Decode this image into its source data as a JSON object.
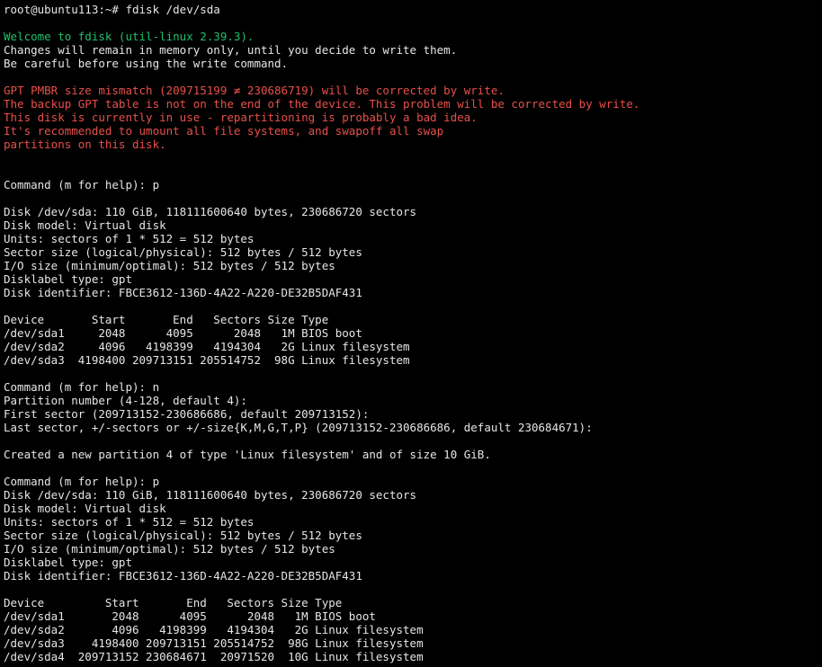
{
  "colors": {
    "background": "#000000",
    "text": "#e6e6e6",
    "welcome": "#20c06a",
    "warning": "#e8504a"
  },
  "lines": [
    {
      "text": "root@ubuntu113:~# fdisk /dev/sda",
      "color": "white"
    },
    {
      "text": "",
      "color": "white"
    },
    {
      "text": "Welcome to fdisk (util-linux 2.39.3).",
      "color": "green"
    },
    {
      "text": "Changes will remain in memory only, until you decide to write them.",
      "color": "white"
    },
    {
      "text": "Be careful before using the write command.",
      "color": "white"
    },
    {
      "text": "",
      "color": "white"
    },
    {
      "text": "GPT PMBR size mismatch (209715199 ≠ 230686719) will be corrected by write.",
      "color": "red"
    },
    {
      "text": "The backup GPT table is not on the end of the device. This problem will be corrected by write.",
      "color": "red"
    },
    {
      "text": "This disk is currently in use - repartitioning is probably a bad idea.",
      "color": "red"
    },
    {
      "text": "It's recommended to umount all file systems, and swapoff all swap",
      "color": "red"
    },
    {
      "text": "partitions on this disk.",
      "color": "red"
    },
    {
      "text": "",
      "color": "white"
    },
    {
      "text": "",
      "color": "white"
    },
    {
      "text": "Command (m for help): p",
      "color": "white"
    },
    {
      "text": "",
      "color": "white"
    },
    {
      "text": "Disk /dev/sda: 110 GiB, 118111600640 bytes, 230686720 sectors",
      "color": "white"
    },
    {
      "text": "Disk model: Virtual disk",
      "color": "white"
    },
    {
      "text": "Units: sectors of 1 * 512 = 512 bytes",
      "color": "white"
    },
    {
      "text": "Sector size (logical/physical): 512 bytes / 512 bytes",
      "color": "white"
    },
    {
      "text": "I/O size (minimum/optimal): 512 bytes / 512 bytes",
      "color": "white"
    },
    {
      "text": "Disklabel type: gpt",
      "color": "white"
    },
    {
      "text": "Disk identifier: FBCE3612-136D-4A22-A220-DE32B5DAF431",
      "color": "white"
    },
    {
      "text": "",
      "color": "white"
    },
    {
      "text": "Device       Start       End   Sectors Size Type",
      "color": "white"
    },
    {
      "text": "/dev/sda1     2048      4095      2048   1M BIOS boot",
      "color": "white"
    },
    {
      "text": "/dev/sda2     4096   4198399   4194304   2G Linux filesystem",
      "color": "white"
    },
    {
      "text": "/dev/sda3  4198400 209713151 205514752  98G Linux filesystem",
      "color": "white"
    },
    {
      "text": "",
      "color": "white"
    },
    {
      "text": "Command (m for help): n",
      "color": "white"
    },
    {
      "text": "Partition number (4-128, default 4):",
      "color": "white"
    },
    {
      "text": "First sector (209713152-230686686, default 209713152):",
      "color": "white"
    },
    {
      "text": "Last sector, +/-sectors or +/-size{K,M,G,T,P} (209713152-230686686, default 230684671):",
      "color": "white"
    },
    {
      "text": "",
      "color": "white"
    },
    {
      "text": "Created a new partition 4 of type 'Linux filesystem' and of size 10 GiB.",
      "color": "white"
    },
    {
      "text": "",
      "color": "white"
    },
    {
      "text": "Command (m for help): p",
      "color": "white"
    },
    {
      "text": "Disk /dev/sda: 110 GiB, 118111600640 bytes, 230686720 sectors",
      "color": "white"
    },
    {
      "text": "Disk model: Virtual disk",
      "color": "white"
    },
    {
      "text": "Units: sectors of 1 * 512 = 512 bytes",
      "color": "white"
    },
    {
      "text": "Sector size (logical/physical): 512 bytes / 512 bytes",
      "color": "white"
    },
    {
      "text": "I/O size (minimum/optimal): 512 bytes / 512 bytes",
      "color": "white"
    },
    {
      "text": "Disklabel type: gpt",
      "color": "white"
    },
    {
      "text": "Disk identifier: FBCE3612-136D-4A22-A220-DE32B5DAF431",
      "color": "white"
    },
    {
      "text": "",
      "color": "white"
    },
    {
      "text": "Device         Start       End   Sectors Size Type",
      "color": "white"
    },
    {
      "text": "/dev/sda1       2048      4095      2048   1M BIOS boot",
      "color": "white"
    },
    {
      "text": "/dev/sda2       4096   4198399   4194304   2G Linux filesystem",
      "color": "white"
    },
    {
      "text": "/dev/sda3    4198400 209713151 205514752  98G Linux filesystem",
      "color": "white"
    },
    {
      "text": "/dev/sda4  209713152 230684671  20971520  10G Linux filesystem",
      "color": "white"
    }
  ]
}
